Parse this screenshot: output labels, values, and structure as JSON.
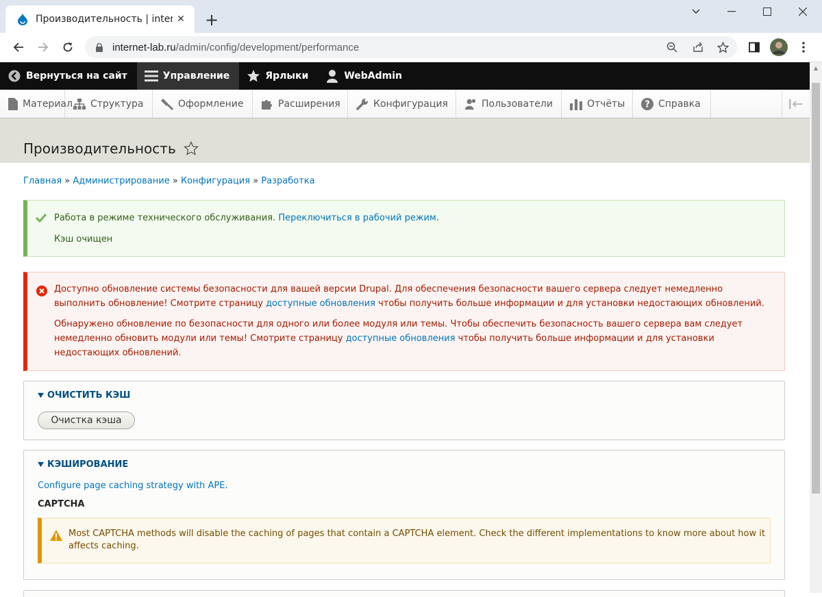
{
  "browser": {
    "tab_title": "Производительность | internet-l",
    "url_host": "internet-lab.ru",
    "url_path": "/admin/config/development/performance"
  },
  "admin_toolbar": {
    "back": "Вернуться на сайт",
    "manage": "Управление",
    "shortcuts": "Ярлыки",
    "user": "WebAdmin"
  },
  "admin_menu": {
    "items": [
      "Материал",
      "Структура",
      "Оформление",
      "Расширения",
      "Конфигурация",
      "Пользователи",
      "Отчёты",
      "Справка"
    ]
  },
  "page": {
    "title": "Производительность"
  },
  "breadcrumb": {
    "items": [
      "Главная",
      "Администрирование",
      "Конфигурация",
      "Разработка"
    ],
    "sep": "»"
  },
  "status": {
    "line1_text": "Работа в режиме технического обслуживания.",
    "line1_link": "Переключиться в рабочий режим",
    "line1_end": ".",
    "line2": "Кэш очищен"
  },
  "error": {
    "p1_a": "Доступно обновление системы безопасности для вашей версии Drupal. Для обеспечения безопасности вашего сервера следует немедленно выполнить обновление! Смотрите страницу ",
    "p1_link": "доступные обновления",
    "p1_b": " чтобы получить больше информации и для установки недостающих обновлений.",
    "p2_a": "Обнаружено обновление по безопасности для одного или более модуля или темы. Чтобы обеспечить безопасность вашего сервера вам следует немедленно обновить модули или темы! Смотрите страницу ",
    "p2_link": "доступные обновления",
    "p2_b": " чтобы получить больше информации и для установки недостающих обновлений."
  },
  "clear_cache": {
    "summary": "ОЧИСТИТЬ КЭШ",
    "button": "Очистка кэша"
  },
  "caching": {
    "summary": "КЭШИРОВАНИЕ",
    "link": "Configure page caching strategy with APE.",
    "captcha_title": "CAPTCHA",
    "warning": "Most CAPTCHA methods will disable the caching of pages that contain a CAPTCHA element. Check the different implementations to know more about how it affects caching."
  },
  "colors": {
    "admin_bar": "#0f0f0f",
    "link": "#0074bd",
    "status_border": "#77b259",
    "error_border": "#e62600",
    "warning_border": "#e09600"
  }
}
